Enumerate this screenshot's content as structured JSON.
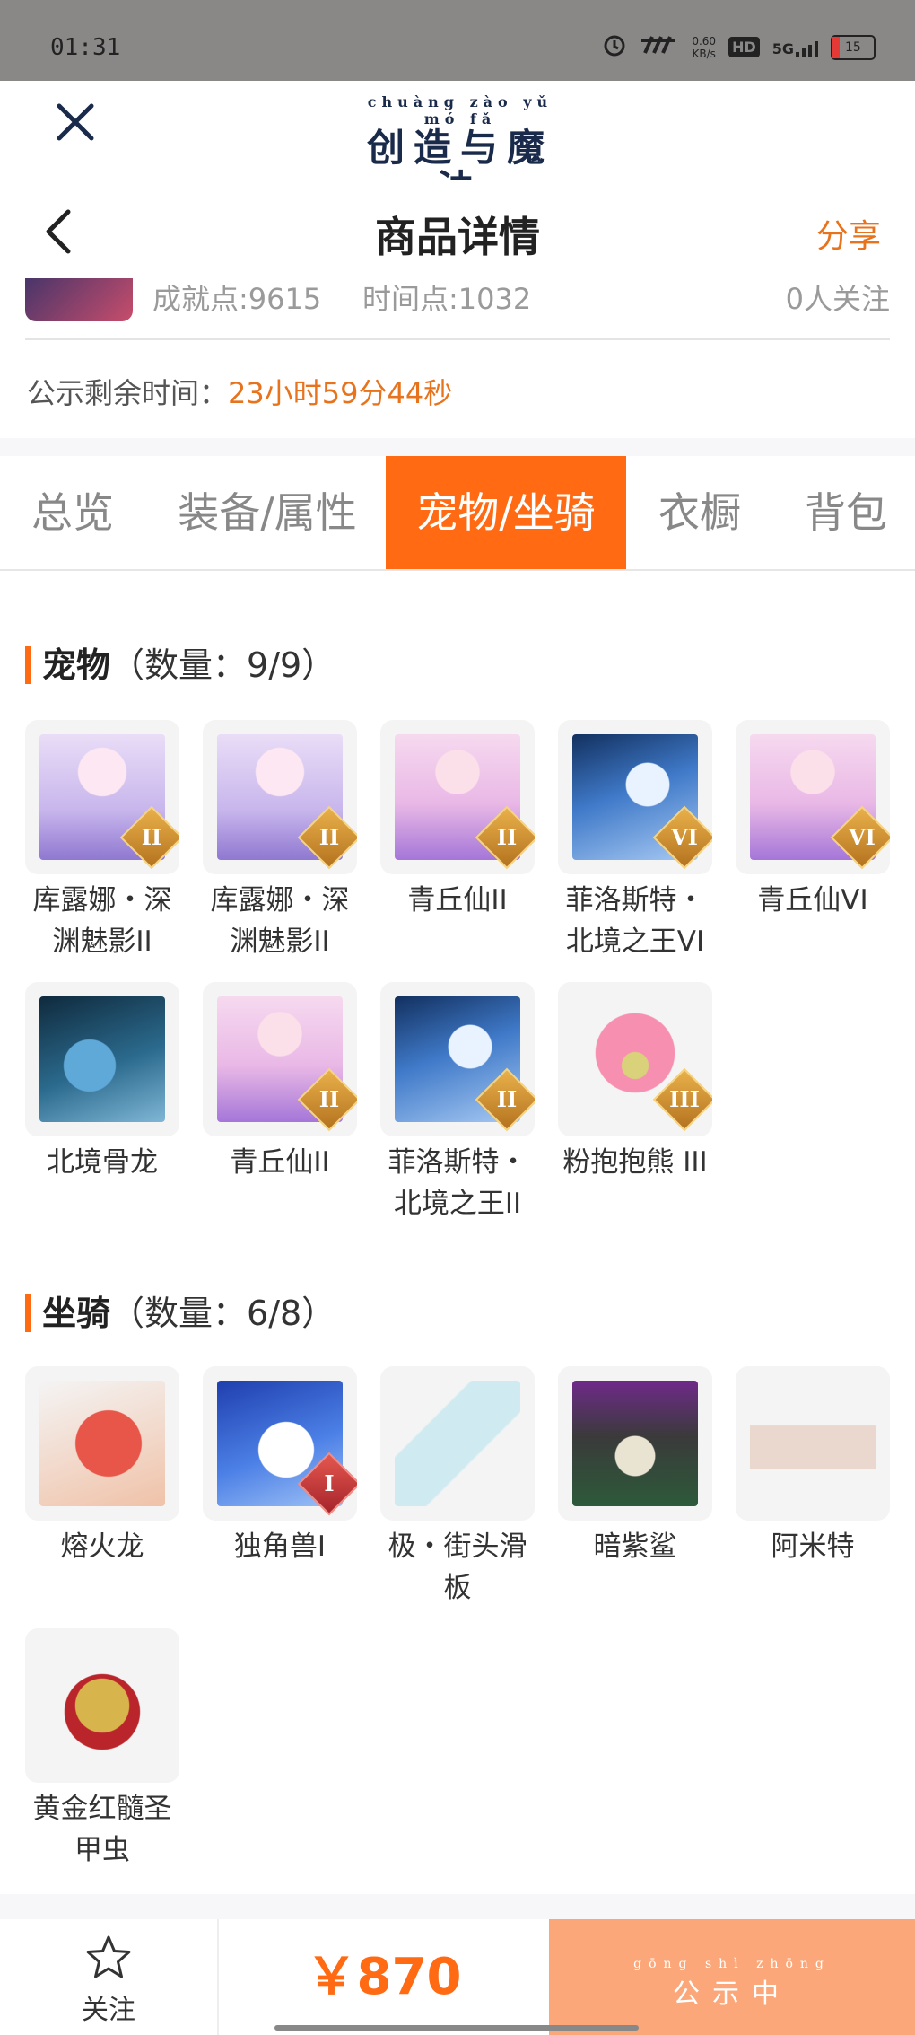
{
  "status_bar": {
    "time": "01:31",
    "net_speed": "0.60\nKB/s",
    "hd_label": "HD",
    "network": "5G",
    "battery": "15"
  },
  "header": {
    "logo_pinyin": "chuàng zào yǔ mó fǎ",
    "logo_title": "创造与魔法",
    "page_title": "商品详情",
    "share_label": "分享"
  },
  "profile": {
    "achievement": "成就点:9615",
    "time_points": "时间点:1032",
    "followers": "0人关注"
  },
  "timer": {
    "label": "公示剩余时间：",
    "value": "23小时59分44秒"
  },
  "tabs": [
    {
      "label": "总览"
    },
    {
      "label": "装备/属性"
    },
    {
      "label": "宠物/坐骑"
    },
    {
      "label": "衣橱"
    },
    {
      "label": "背包"
    }
  ],
  "pets": {
    "title": "宠物",
    "count_label": "（数量：9/9）",
    "items": [
      {
        "name": "库露娜・深渊魅影II",
        "badge": "II",
        "icon": "pet-kuluna-icon"
      },
      {
        "name": "库露娜・深渊魅影II",
        "badge": "II",
        "icon": "pet-kuluna-icon"
      },
      {
        "name": "青丘仙II",
        "badge": "II",
        "icon": "pet-qingqiu-icon"
      },
      {
        "name": "菲洛斯特・北境之王VI",
        "badge": "VI",
        "icon": "pet-feilosite-icon"
      },
      {
        "name": "青丘仙VI",
        "badge": "VI",
        "icon": "pet-qingqiu-icon"
      },
      {
        "name": "北境骨龙",
        "badge": "",
        "icon": "pet-bone-dragon-icon"
      },
      {
        "name": "青丘仙II",
        "badge": "II",
        "icon": "pet-qingqiu-icon"
      },
      {
        "name": "菲洛斯特・北境之王II",
        "badge": "II",
        "icon": "pet-feilosite-icon"
      },
      {
        "name": "粉抱抱熊 III",
        "badge": "III",
        "icon": "pet-pink-bear-icon"
      }
    ]
  },
  "mounts": {
    "title": "坐骑",
    "count_label": "（数量：6/8）",
    "items": [
      {
        "name": "熔火龙",
        "badge": "",
        "icon": "mount-fire-dragon-icon"
      },
      {
        "name": "独角兽I",
        "badge": "I",
        "icon": "mount-unicorn-icon"
      },
      {
        "name": "极・街头滑板",
        "badge": "",
        "icon": "mount-skateboard-icon"
      },
      {
        "name": "暗紫鲨",
        "badge": "",
        "icon": "mount-purple-shark-icon"
      },
      {
        "name": "阿米特",
        "badge": "",
        "icon": "mount-ammit-icon"
      },
      {
        "name": "黄金红髓圣甲虫",
        "badge": "",
        "icon": "mount-golden-beetle-icon"
      }
    ]
  },
  "bottom": {
    "follow_label": "关注",
    "price": "￥870",
    "cta_pinyin": "gōng shì zhōng",
    "cta_text": "公示中"
  },
  "colors": {
    "accent": "#ff6a13",
    "accent_text": "#e8731d",
    "cta_bg": "#fba779"
  }
}
